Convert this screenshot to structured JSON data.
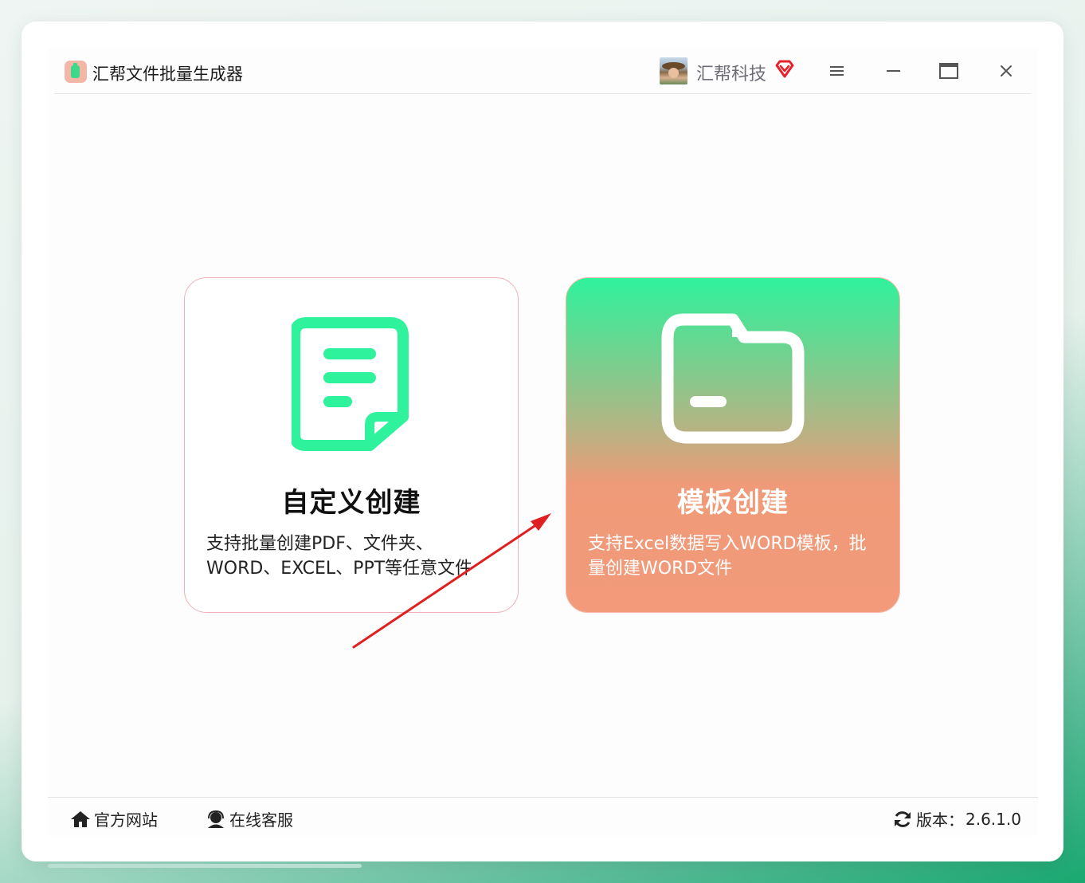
{
  "app": {
    "title": "汇帮文件批量生成器",
    "company": "汇帮科技"
  },
  "cards": [
    {
      "title": "自定义创建",
      "desc_line1": "支持批量创建PDF、文件夹、",
      "desc_line2": "WORD、EXCEL、PPT等任意文件",
      "icon": "document-icon"
    },
    {
      "title": "模板创建",
      "desc_line1": "支持Excel数据写入WORD模板，批",
      "desc_line2": "量创建WORD文件",
      "icon": "folder-icon"
    }
  ],
  "footer": {
    "website": "官方网站",
    "service": "在线客服",
    "version_label": "版本：",
    "version_value": "2.6.1.0"
  },
  "colors": {
    "accent_green": "#2ff29c",
    "accent_salmon": "#f29a7a",
    "vip_red": "#e5232c",
    "arrow_red": "#e02020"
  }
}
